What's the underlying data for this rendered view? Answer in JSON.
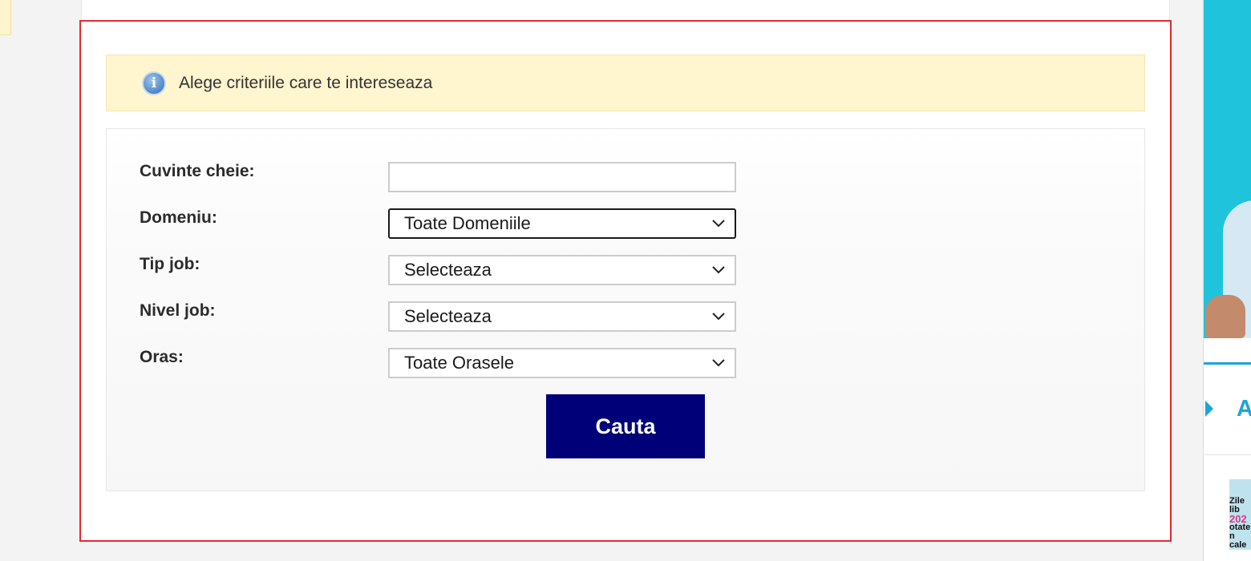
{
  "info": {
    "icon": "info-icon",
    "icon_glyph": "i",
    "text": "Alege criteriile care te intereseaza"
  },
  "form": {
    "keywords": {
      "label": "Cuvinte cheie:",
      "value": ""
    },
    "domain": {
      "label": "Domeniu:",
      "selected": "Toate Domeniile"
    },
    "job_type": {
      "label": "Tip job:",
      "selected": "Selecteaza"
    },
    "job_level": {
      "label": "Nivel job:",
      "selected": "Selecteaza"
    },
    "city": {
      "label": "Oras:",
      "selected": "Toate Orasele"
    },
    "search_label": "Cauta"
  },
  "sidebar": {
    "letter": "A",
    "thumb_lines": [
      "Zile lib",
      "202",
      "otate",
      "n cale"
    ]
  },
  "colors": {
    "panel_border": "#e32b2b",
    "info_bg": "#fff5cf",
    "button_bg": "#000079",
    "accent": "#1fa3dc",
    "ad_bg": "#1fc3dc"
  }
}
